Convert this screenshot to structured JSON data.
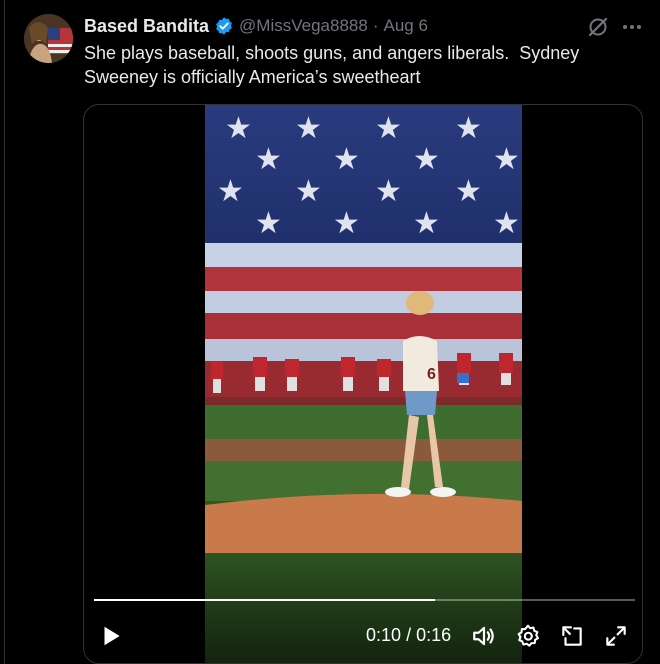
{
  "post": {
    "display_name": "Based Bandita",
    "handle": "@MissVega8888",
    "separator": "·",
    "date": "Aug 6",
    "text": "She plays baseball, shoots guns, and angers liberals.  Sydney Sweeney is officially America’s sweetheart",
    "verified_color": "#1d9bf0"
  },
  "video": {
    "current_time": "0:10",
    "duration": "0:16",
    "progress": 0.63,
    "jersey_number": "6"
  },
  "icons": {
    "grok": "grok-icon",
    "more": "more-icon",
    "play": "play-icon",
    "volume": "volume-icon",
    "settings": "gear-icon",
    "pip": "picture-in-picture-icon",
    "fullscreen": "fullscreen-icon"
  }
}
